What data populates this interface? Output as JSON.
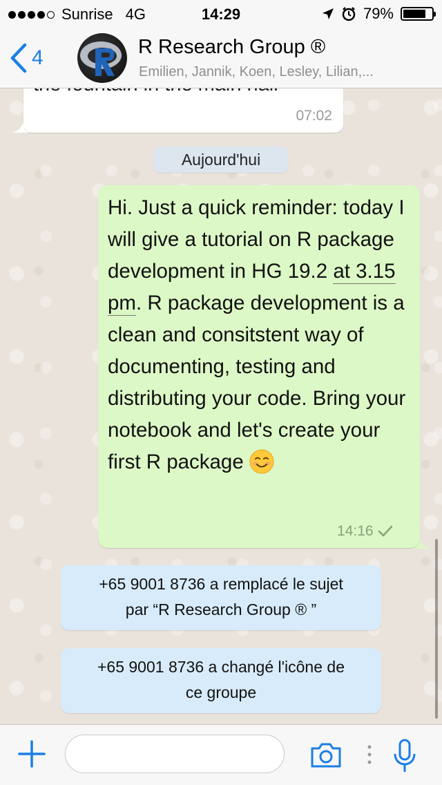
{
  "status_bar": {
    "carrier": "Sunrise",
    "network": "4G",
    "time": "14:29",
    "battery_percent": "79%",
    "battery_level": 0.79,
    "signal_bars_filled": 4,
    "icons": [
      "location-arrow-icon",
      "alarm-icon",
      "battery-icon"
    ]
  },
  "header": {
    "back_count": "4",
    "title": "R Research Group ®",
    "subtitle": "Emilien, Jannik, Koen, Lesley, Lilian,...",
    "avatar_letter": "R"
  },
  "messages": {
    "previous": {
      "text_fragment": "the fountain in the main hall",
      "time": "07:02"
    },
    "date_separator": "Aujourd'hui",
    "outgoing": {
      "text_before_link": "Hi. Just a quick reminder: today I will give a tutorial on R package development in HG 19.2 ",
      "link_text": "at 3.15 pm",
      "text_after_link": ". R package development is a clean and consitstent way of documenting, testing and distributing your code. Bring your notebook and let's create your first R package ",
      "emoji": "smiling-face-emoji",
      "time": "14:16",
      "status": "sent-check-icon"
    },
    "system": [
      {
        "line1": "+65 9001 8736 a remplacé le sujet",
        "line2": "par “R Research Group ® ”"
      },
      {
        "line1": "+65 9001 8736 a changé l'icône de",
        "line2": "ce groupe"
      }
    ]
  },
  "input_bar": {
    "placeholder": "",
    "icons": [
      "plus-icon",
      "camera-icon",
      "more-icon",
      "microphone-icon"
    ]
  },
  "colors": {
    "accent": "#1a7ee6",
    "outgoing_bubble": "#dcf8c6",
    "incoming_bubble": "#ffffff",
    "system_bubble": "#d8ebfa",
    "date_chip": "#dde5ef"
  }
}
